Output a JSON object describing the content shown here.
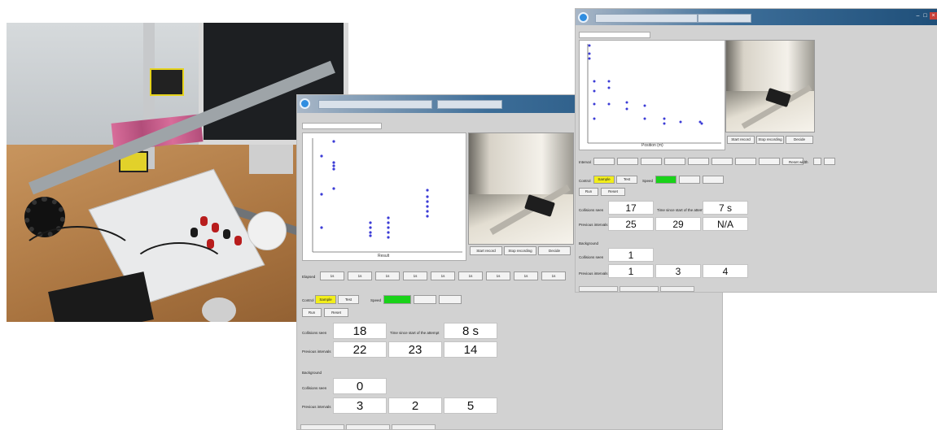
{
  "window1": {
    "plot_xlabel": "Result",
    "video_buttons": [
      "Start record",
      "Stop recording",
      "Decide"
    ],
    "ticks_label": "Elapsed",
    "ticks": [
      "1s",
      "1s",
      "1s",
      "1s",
      "1s",
      "1s",
      "1s",
      "1s",
      "1s"
    ],
    "cond_label": "Control",
    "cond_buttons": [
      "Sample",
      "Test"
    ],
    "speed_label": "Speed",
    "speed_buttons": [
      "",
      "",
      ""
    ],
    "small_buttons": [
      "Run",
      "Reset"
    ],
    "row1_label": "Collisions seen",
    "row1_value": "18",
    "row1_mid_label": "Time since start of the attempt",
    "row1_right": "8 s",
    "row2_label": "Previous intervals",
    "row2_values": [
      "22",
      "23",
      "14"
    ],
    "section2_label": "Background",
    "row3_label": "Collisions seen",
    "row3_value": "0",
    "row4_label": "Previous intervals",
    "row4_values": [
      "3",
      "2",
      "5"
    ]
  },
  "window2": {
    "plot_xlabel": "Position (m)",
    "video_buttons": [
      "Start record",
      "Stop recording",
      "Decide"
    ],
    "ticks_label": "Interval",
    "ticks": [
      "",
      "",
      "",
      "",
      "",
      "",
      "",
      "",
      ""
    ],
    "ticks_after": "Reset width",
    "cond_label": "Control",
    "cond_buttons": [
      "Sample",
      "Test"
    ],
    "speed_label": "Speed",
    "speed_buttons": [
      "",
      "",
      ""
    ],
    "small_buttons": [
      "Run",
      "Reset"
    ],
    "row1_label": "Collisions seen",
    "row1_value": "17",
    "row1_mid_label": "Time since start of the attempt",
    "row1_right": "7 s",
    "row2_label": "Previous intervals",
    "row2_values": [
      "25",
      "29",
      "N/A"
    ],
    "section2_label": "Background",
    "row3_label": "Collisions seen",
    "row3_value": "1",
    "row4_label": "Previous intervals",
    "row4_values": [
      "1",
      "3",
      "4"
    ]
  },
  "colors": {
    "selected_condition": "#f2ee1a",
    "selected_speed": "#19d219",
    "plot_points": "#3b3bd6",
    "titlebar": "#1f4f79"
  },
  "icons": [
    "app-icon",
    "minimize-icon",
    "maximize-icon",
    "close-icon"
  ]
}
